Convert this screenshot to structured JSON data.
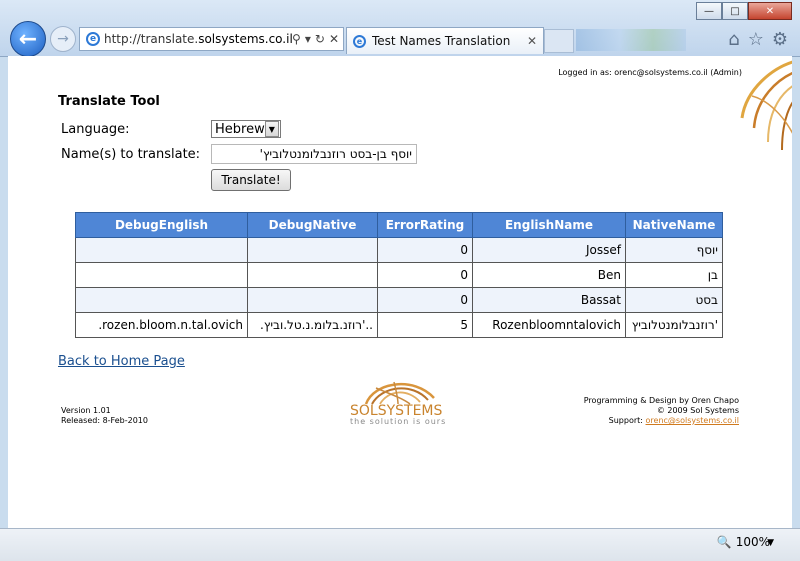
{
  "browser": {
    "url_prefix": "http://translate.",
    "url_domain": "solsystems.co.il",
    "tab_title": "Test Names Translation",
    "zoom": "100%"
  },
  "header": {
    "logged_in": "Logged in as: orenc@solsystems.co.il (Admin)"
  },
  "form": {
    "title": "Translate Tool",
    "language_label": "Language:",
    "language_value": "Hebrew",
    "names_label": "Name(s) to translate:",
    "names_value": "יוסף בן-בסט רוזנבלומנטלוביץ'",
    "translate_button": "Translate!"
  },
  "table": {
    "headers": [
      "DebugEnglish",
      "DebugNative",
      "ErrorRating",
      "EnglishName",
      "NativeName"
    ],
    "rows": [
      [
        "",
        "",
        "0",
        "Jossef",
        "יוסף"
      ],
      [
        "",
        "",
        "0",
        "Ben",
        "בן"
      ],
      [
        "",
        "",
        "0",
        "Bassat",
        "בסט"
      ],
      [
        ".rozen.bloom.n.tal.ovich",
        ".רוזנ.בלומ.נ.טל.וביץ'..",
        "5",
        "Rozenbloomntalovich",
        "רוזנבלומנטלוביץ'"
      ]
    ]
  },
  "links": {
    "back_home": "Back to Home Page"
  },
  "footer": {
    "version": "Version 1.01",
    "released": "Released: 8-Feb-2010",
    "logo_name": "SOLSYSTEMS",
    "logo_tagline": "the solution is ours",
    "credits_line1": "Programming & Design by Oren Chapo",
    "credits_line2": "© 2009 Sol Systems",
    "support_label": "Support:",
    "support_email": "orenc@solsystems.co.il"
  },
  "colors": {
    "table_header": "#4f86d6",
    "alt_row": "#eef3fb",
    "link": "#1a4f8f",
    "logo": "#c9842e"
  }
}
